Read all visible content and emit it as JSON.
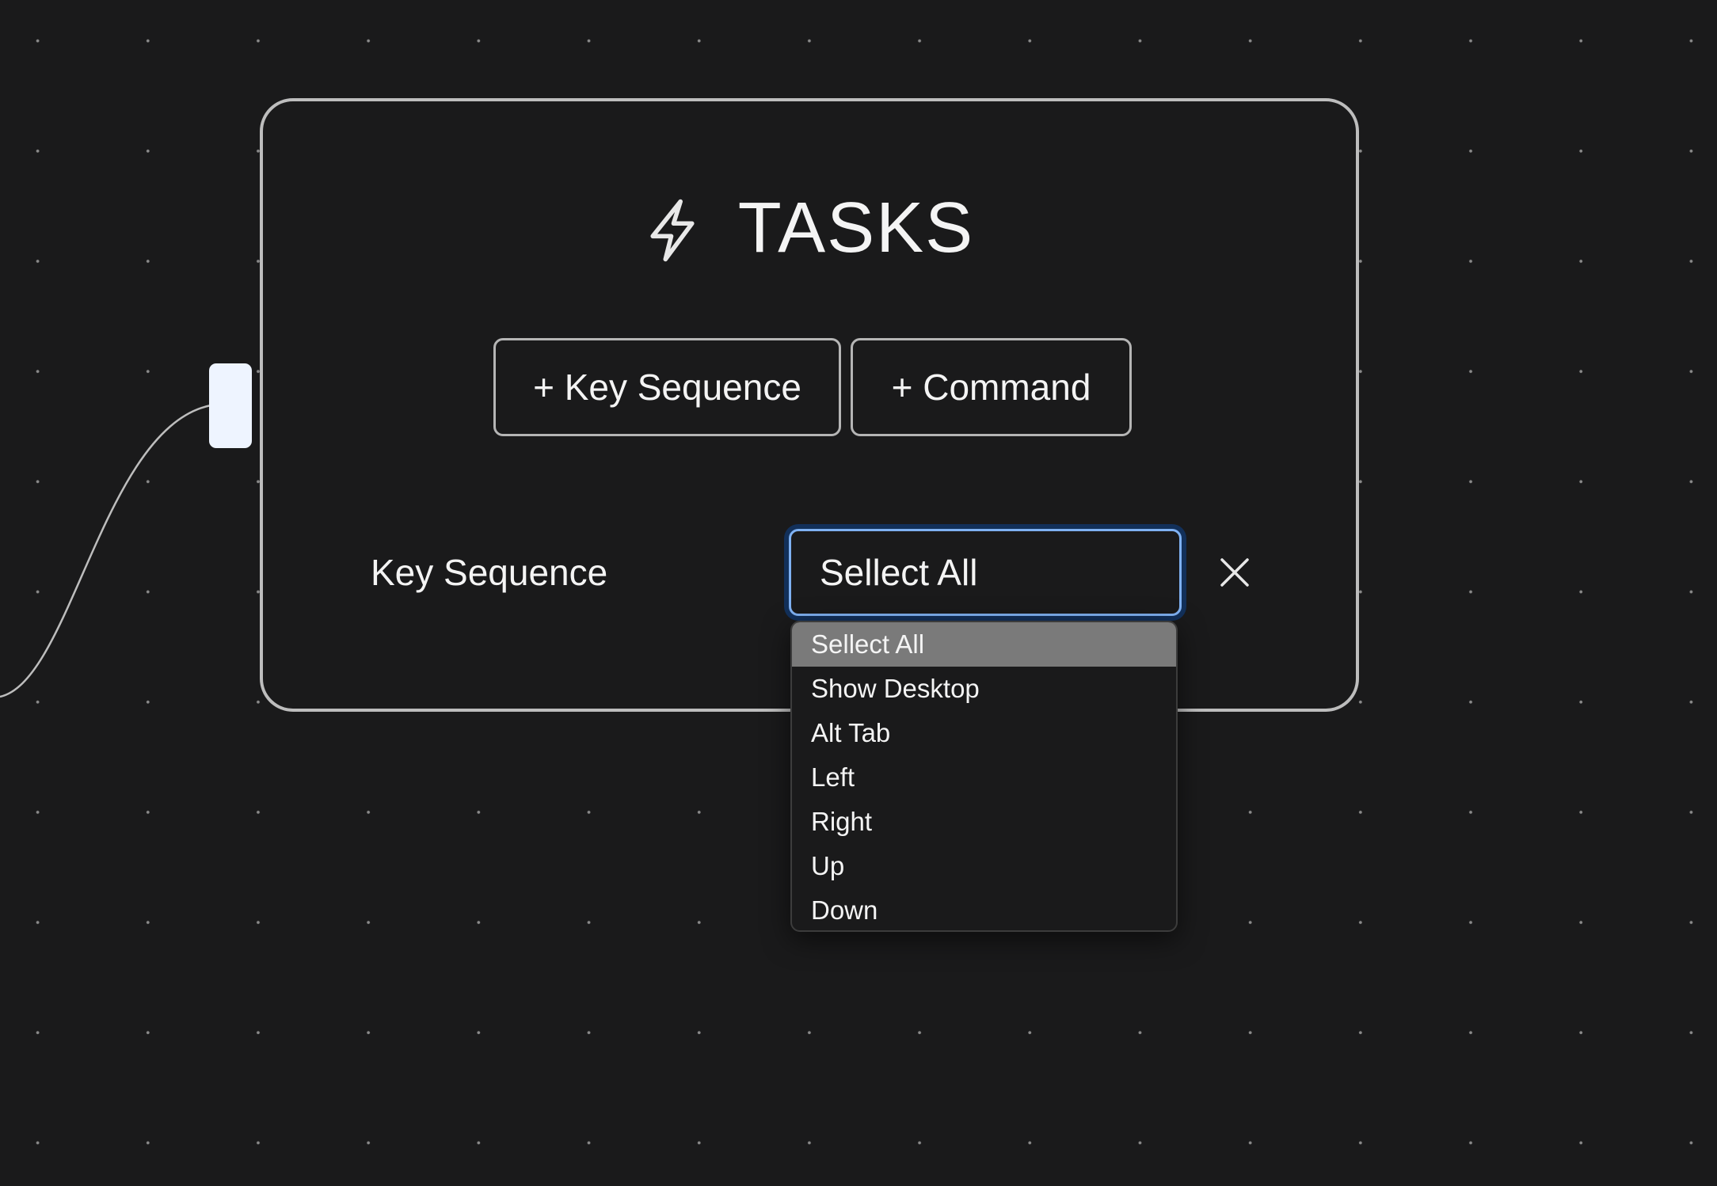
{
  "canvas": {
    "background_color": "#1a1a1b",
    "dot_color": "#8a8a8a"
  },
  "task_node": {
    "header": {
      "icon": "lightning-bolt-icon",
      "title": "TASKS"
    },
    "buttons": {
      "add_key_sequence": "+ Key Sequence",
      "add_command": "+ Command"
    },
    "key_sequence_field": {
      "label": "Key Sequence",
      "selected_value": "Sellect All",
      "clear_icon": "close-icon",
      "focus_color": "#7fb1f2"
    },
    "dropdown": {
      "options": [
        "Sellect All",
        "Show Desktop",
        "Alt Tab",
        "Left",
        "Right",
        "Up",
        "Down"
      ],
      "highlighted_index": 0,
      "highlight_color": "#7a7a7a"
    }
  }
}
